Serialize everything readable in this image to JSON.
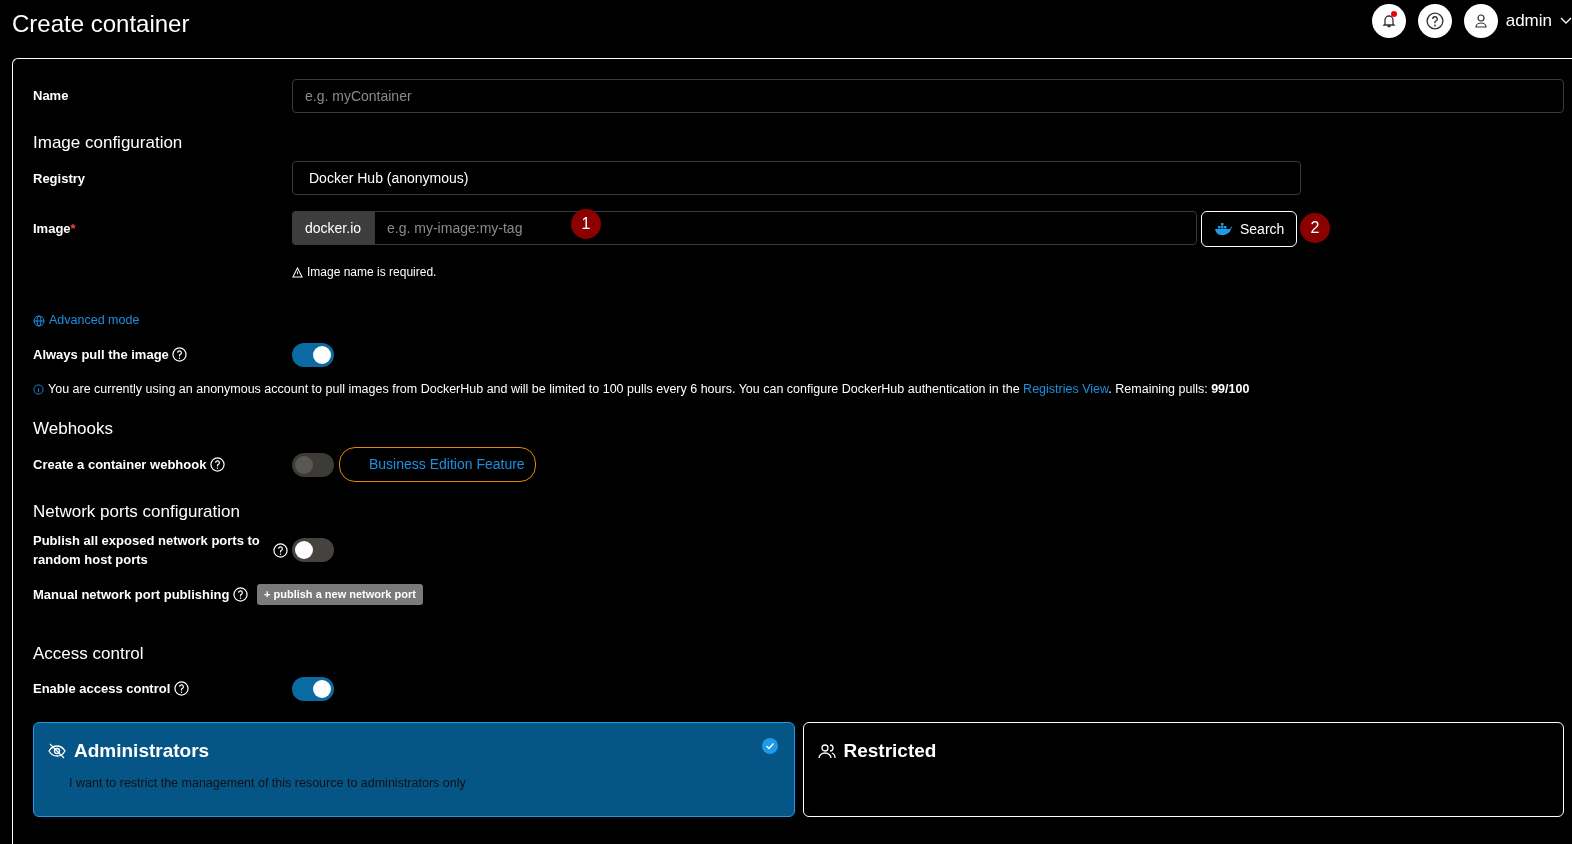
{
  "header": {
    "title": "Create container",
    "notification_alert": true,
    "user": "admin"
  },
  "name_field": {
    "label": "Name",
    "placeholder": "e.g. myContainer"
  },
  "image_section": {
    "title": "Image configuration",
    "registry_label": "Registry",
    "registry_value": "Docker Hub (anonymous)",
    "image_label": "Image",
    "required_mark": "*",
    "image_prefix": "docker.io",
    "image_placeholder": "e.g. my-image:my-tag",
    "search_button": "Search",
    "error": "Image name is required.",
    "advanced_link": "Advanced mode",
    "markers": [
      "1",
      "2"
    ]
  },
  "pull": {
    "label": "Always pull the image",
    "on": true
  },
  "info": {
    "before": "You are currently using an anonymous account to pull images from DockerHub and will be limited to 100 pulls every 6 hours. You can configure DockerHub authentication in the ",
    "link": "Registries View",
    "after": ". Remaining pulls: **99/100**"
  },
  "webhooks": {
    "title": "Webhooks",
    "label": "Create a container webhook",
    "on": false,
    "disabled": true,
    "badge": "Business Edition Feature"
  },
  "ports": {
    "title": "Network ports configuration",
    "publish_label": "Publish all exposed network ports to random host ports",
    "publish_on": false,
    "manual_label": "Manual network port publishing",
    "add_button": "+ publish a new network port"
  },
  "access": {
    "title": "Access control",
    "label": "Enable access control",
    "on": true,
    "options": [
      {
        "kind": "admin",
        "title": "Administrators",
        "description": "I want to restrict the management of this resource to administrators only",
        "selected": true
      },
      {
        "kind": "restricted",
        "title": "Restricted",
        "selected": false
      }
    ]
  }
}
